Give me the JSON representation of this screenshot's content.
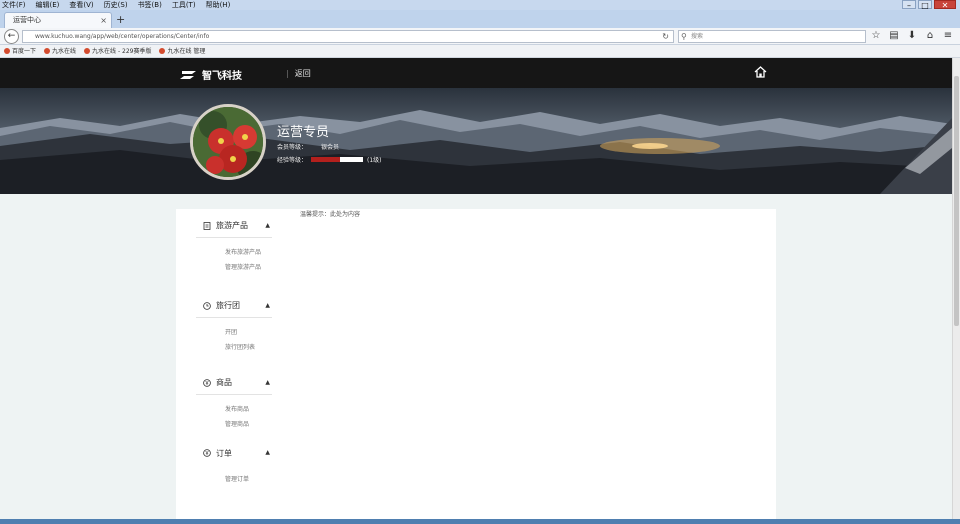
{
  "browser": {
    "menus": [
      "文件(F)",
      "编辑(E)",
      "查看(V)",
      "历史(S)",
      "书签(B)",
      "工具(T)",
      "帮助(H)"
    ],
    "tab_title": "运营中心",
    "url": "www.kuchuo.wang/app/web/center/operations/Center/info",
    "search_placeholder": "搜索",
    "bookmarks": [
      "百度一下",
      "九水在线",
      "九水在线 - 229赛季版",
      "九水在线 管理"
    ]
  },
  "header": {
    "brand": "智飞科技",
    "nav_home": "返回"
  },
  "profile": {
    "role_title": "运营专员",
    "member_label": "会员等级：",
    "member_value": "银会员",
    "level_label": "经验等级：",
    "level_progress": 0.55,
    "level_suffix": "(1级)"
  },
  "tip": "温馨提示：此处为内容",
  "sidebar": [
    {
      "title": "旅游产品",
      "icon": "document-icon",
      "items": [
        "发布旅游产品",
        "管理旅游产品"
      ]
    },
    {
      "title": "旅行团",
      "icon": "clock-icon",
      "items": [
        "开团",
        "旅行团列表"
      ]
    },
    {
      "title": "商品",
      "icon": "yen-icon",
      "items": [
        "发布商品",
        "管理商品"
      ]
    },
    {
      "title": "订单",
      "icon": "yen-icon",
      "items": [
        "管理订单"
      ]
    }
  ],
  "colors": {
    "header_bg": "#161616",
    "progress_fill": "#b3201d",
    "page_bg": "#eef3f3"
  }
}
